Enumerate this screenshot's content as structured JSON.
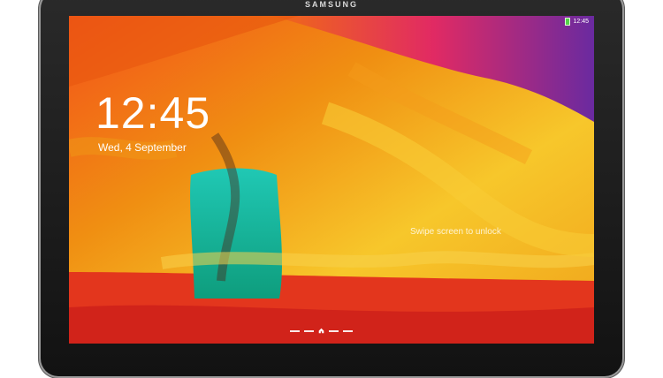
{
  "device": {
    "brand": "SAMSUNG"
  },
  "status_bar": {
    "time": "12:45",
    "battery_color": "#55d34a"
  },
  "lockscreen": {
    "clock": "12:45",
    "date": "Wed, 4 September",
    "unlock_hint": "Swipe screen to unlock",
    "pager": {
      "pages": 4,
      "current": 2,
      "home_icon": "home-icon"
    }
  },
  "colors": {
    "bezel": "#1c1c1c",
    "wall_orange": "#f19a14",
    "wall_yellow": "#f6c42a",
    "wall_red": "#e3361d",
    "wall_teal": "#1fc3b2",
    "wall_purple": "#7c2aa1"
  }
}
